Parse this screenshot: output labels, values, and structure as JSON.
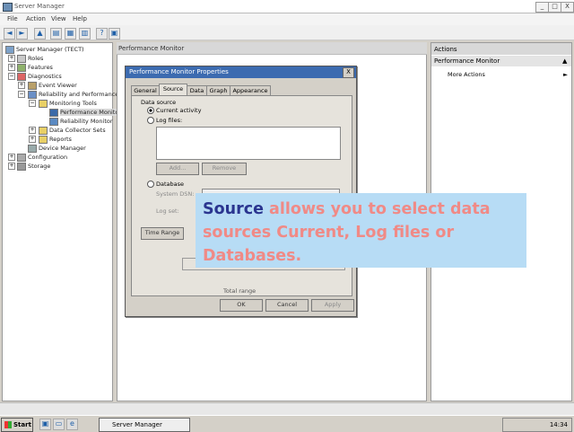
{
  "window": {
    "title": "Server Manager",
    "buttons": [
      "_",
      "□",
      "X"
    ]
  },
  "menu": [
    "File",
    "Action",
    "View",
    "Help"
  ],
  "toolbar_icons": [
    "back-icon",
    "forward-icon",
    "up-icon",
    "properties-icon",
    "print-icon",
    "help-icon",
    "refresh-icon"
  ],
  "tree": {
    "items": [
      {
        "label": "Server Manager (TECT)",
        "level": 0
      },
      {
        "label": "Roles",
        "level": 1
      },
      {
        "label": "Features",
        "level": 1
      },
      {
        "label": "Diagnostics",
        "level": 1
      },
      {
        "label": "Event Viewer",
        "level": 2
      },
      {
        "label": "Reliability and Performance",
        "level": 2
      },
      {
        "label": "Monitoring Tools",
        "level": 3
      },
      {
        "label": "Performance Monitor",
        "level": 4
      },
      {
        "label": "Reliability Monitor",
        "level": 4
      },
      {
        "label": "Data Collector Sets",
        "level": 3
      },
      {
        "label": "Reports",
        "level": 3
      },
      {
        "label": "Device Manager",
        "level": 2
      },
      {
        "label": "Configuration",
        "level": 1
      },
      {
        "label": "Storage",
        "level": 1
      }
    ]
  },
  "main": {
    "header": "Performance Monitor"
  },
  "actions": {
    "header": "Actions",
    "section": "Performance Monitor",
    "more": "More Actions"
  },
  "dialog": {
    "title": "Performance Monitor Properties",
    "close": "X",
    "tabs": [
      "General",
      "Source",
      "Data",
      "Graph",
      "Appearance"
    ],
    "active_tab": "Source",
    "data_source_label": "Data source",
    "opt_current": "Current activity",
    "opt_log": "Log files:",
    "add": "Add...",
    "remove": "Remove",
    "opt_database": "Database",
    "system_dsn": "System DSN:",
    "log_set": "Log set:",
    "time_range": "Time Range",
    "total_range": "Total range",
    "ok": "OK",
    "cancel": "Cancel",
    "apply": "Apply"
  },
  "callout": {
    "keyword": "Source",
    "text": " allows you to select data sources Current, Log files or Databases."
  },
  "taskbar": {
    "start": "Start",
    "task": "Server Manager",
    "time": "14:34"
  },
  "colors": {
    "callout_bg": "#b7dcf5",
    "callout_keyword": "#2a3590",
    "callout_text": "#f08a86",
    "dialog_title": "#3c6bb0"
  }
}
